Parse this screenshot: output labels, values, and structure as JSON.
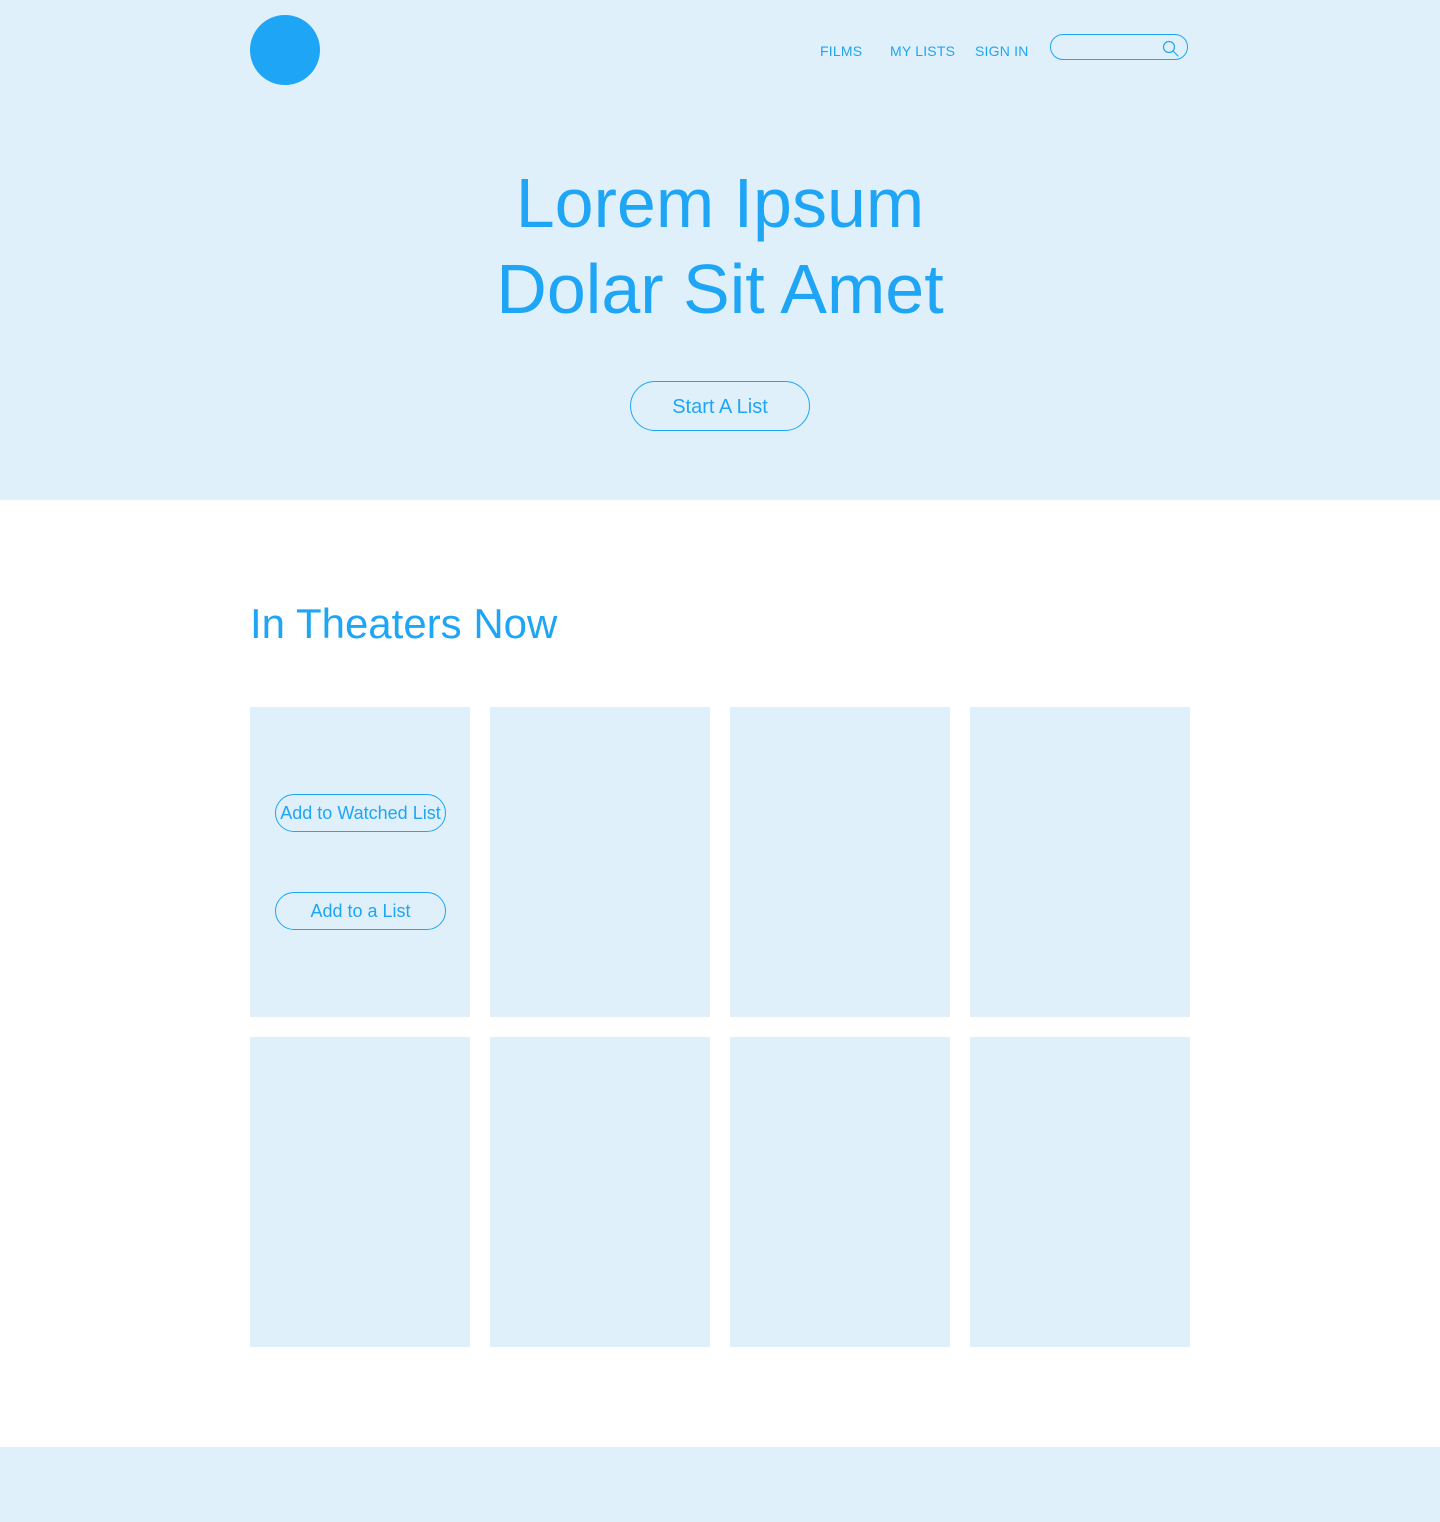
{
  "colors": {
    "accent": "#1ea5f5",
    "panel": "#e0f0fb",
    "background": "#ffffff"
  },
  "header": {
    "logo_icon": "circle-logo",
    "nav": [
      {
        "label": "FILMS"
      },
      {
        "label": "MY LISTS"
      },
      {
        "label": "SIGN IN"
      }
    ],
    "search": {
      "placeholder": "",
      "value": "",
      "icon": "search-icon"
    }
  },
  "hero": {
    "title_line1": "Lorem Ipsum",
    "title_line2": "Dolar Sit Amet",
    "cta_label": "Start A List"
  },
  "section": {
    "title": "In Theaters Now",
    "cards": [
      {
        "watched_label": "Add to Watched List",
        "list_label": "Add to a List"
      },
      {},
      {},
      {},
      {},
      {},
      {},
      {}
    ]
  }
}
